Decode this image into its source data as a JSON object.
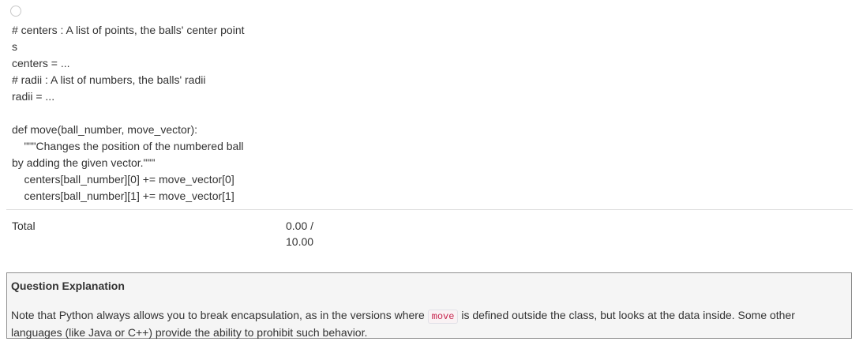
{
  "code": {
    "lines": [
      "# centers : A list of points, the balls' center point",
      "s",
      "centers = ...",
      "# radii : A list of numbers, the balls' radii",
      "radii = ...",
      "",
      "def move(ball_number, move_vector):",
      "    \"\"\"Changes the position of the numbered ball",
      "by adding the given vector.\"\"\"",
      "    centers[ball_number][0] += move_vector[0]",
      "    centers[ball_number][1] += move_vector[1]"
    ]
  },
  "score": {
    "label": "Total",
    "value_line1": "0.00 /",
    "value_line2": "10.00"
  },
  "explanation": {
    "title": "Question Explanation",
    "text_before": "Note that Python always allows you to break encapsulation, as in the versions where ",
    "code": "move",
    "text_after": " is defined outside the class, but looks at the data inside. Some other languages (like Java or C++) provide the ability to prohibit such behavior."
  }
}
